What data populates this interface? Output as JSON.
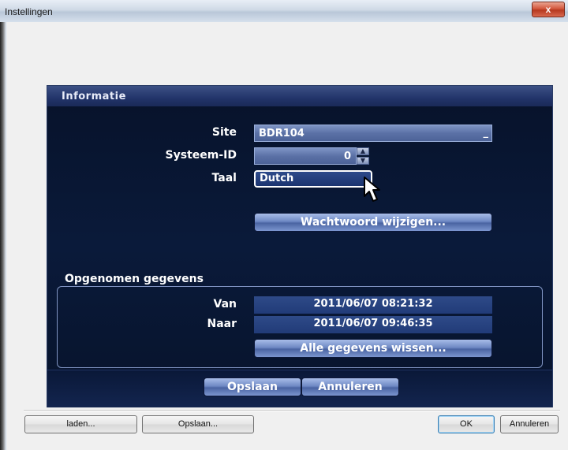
{
  "window": {
    "title": "Instellingen",
    "close_glyph": "x"
  },
  "panel": {
    "title": "Informatie",
    "site": {
      "label": "Site",
      "value": "BDR104",
      "suffix": "_"
    },
    "system_id": {
      "label": "Systeem-ID",
      "value": "0"
    },
    "language": {
      "label": "Taal",
      "value": "Dutch"
    },
    "change_password_label": "Wachtwoord wijzigen...",
    "recorded": {
      "title": "Opgenomen gegevens",
      "from_label": "Van",
      "from_value": "2011/06/07  08:21:32",
      "to_label": "Naar",
      "to_value": "2011/06/07  09:46:35",
      "wipe_label": "Alle gegevens wissen..."
    },
    "save_label": "Opslaan",
    "cancel_label": "Annuleren"
  },
  "footer": {
    "load_label": "laden...",
    "save_label": "Opslaan...",
    "ok_label": "OK",
    "cancel_label": "Annuleren"
  }
}
